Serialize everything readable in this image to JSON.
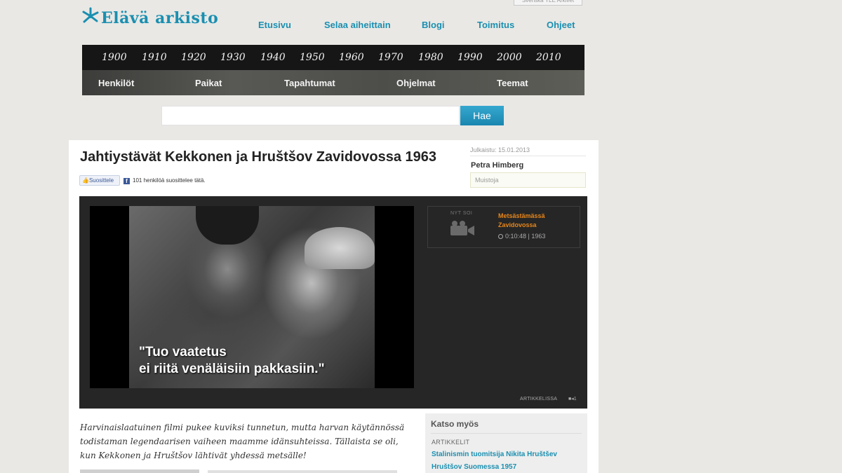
{
  "site": {
    "logo_text": "Elävä arkisto",
    "corner_link": "Svenska YLE Arkivet"
  },
  "topnav": [
    {
      "label": "Etusivu"
    },
    {
      "label": "Selaa aiheittain"
    },
    {
      "label": "Blogi"
    },
    {
      "label": "Toimitus"
    },
    {
      "label": "Ohjeet"
    }
  ],
  "decades": [
    "1900",
    "1910",
    "1920",
    "1930",
    "1940",
    "1950",
    "1960",
    "1970",
    "1980",
    "1990",
    "2000",
    "2010"
  ],
  "categories": [
    "Henkilöt",
    "Paikat",
    "Tapahtumat",
    "Ohjelmat",
    "Teemat"
  ],
  "search": {
    "value": "",
    "button_label": "Hae"
  },
  "article": {
    "title": "Jahtiystävät Kekkonen ja Hruštšov Zavidovossa 1963",
    "like_label": "Suosittele",
    "like_count_text": "101 henkilöä suosittelee tätä.",
    "published": "Julkaistu: 15.01.2013",
    "author": "Petra Himberg",
    "memories_label": "Muistoja",
    "lead": "Harvinaislaatuinen filmi pukee kuviksi tunnetun, mutta harvan käytännössä todistaman legendaarisen vaiheen maamme idänsuhteissa. Tällaista se oli, kun Kekkonen ja Hruštšov lähtivät yhdessä metsälle!"
  },
  "player": {
    "subtitle_line1": "\"Tuo vaatetus",
    "subtitle_line2": "ei riitä venäläisiin pakkasiin.\"",
    "now_playing_label": "NYT SOI",
    "now_playing_title": "Metsästämässä Zavidovossa",
    "now_playing_meta": "0:10:48 | 1963",
    "in_article_label": "ARTIKKELISSA",
    "in_article_count": "1"
  },
  "see_also": {
    "heading": "Katso myös",
    "category": "ARTIKKELIT",
    "links": [
      {
        "label": "Stalinismin tuomitsija Nikita Hruštšev"
      },
      {
        "label": "Hruštšov Suomessa 1957"
      }
    ]
  },
  "colors": {
    "brand": "#1a8fb0",
    "accent_orange": "#e8861a",
    "search_button": "#1a86b0"
  }
}
